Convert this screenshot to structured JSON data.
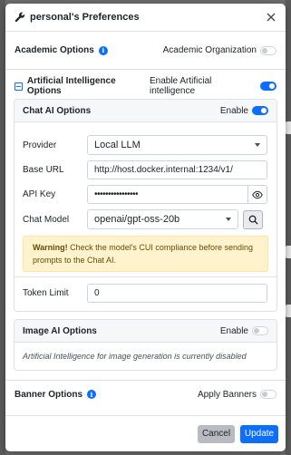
{
  "modal": {
    "title": "personal's Preferences"
  },
  "academic": {
    "title": "Academic Options",
    "org_label": "Academic Organization",
    "org_enabled": false
  },
  "ai": {
    "title": "Artificial Intelligence Options",
    "enable_label": "Enable Artificial intelligence",
    "enabled": true
  },
  "chat": {
    "title": "Chat AI Options",
    "enable_label": "Enable",
    "enabled": true,
    "provider_label": "Provider",
    "provider_value": "Local LLM",
    "base_url_label": "Base URL",
    "base_url_value": "http://host.docker.internal:1234/v1/",
    "api_key_label": "API Key",
    "api_key_value": "••••••••••••••••",
    "model_label": "Chat Model",
    "model_value": "openai/gpt-oss-20b",
    "warning_strong": "Warning!",
    "warning_text": " Check the model's CUI compliance before sending prompts to the Chat AI.",
    "token_label": "Token Limit",
    "token_value": "0"
  },
  "image": {
    "title": "Image AI Options",
    "enable_label": "Enable",
    "enabled": false,
    "note": "Artificial Intelligence for image generation is currently disabled"
  },
  "banner": {
    "title": "Banner Options",
    "apply_label": "Apply Banners",
    "enabled": false
  },
  "footer": {
    "cancel_label": "Cancel",
    "update_label": "Update"
  },
  "colors": {
    "primary": "#0d6efd",
    "warning_bg": "#fff3cd",
    "warning_text": "#664d03"
  }
}
